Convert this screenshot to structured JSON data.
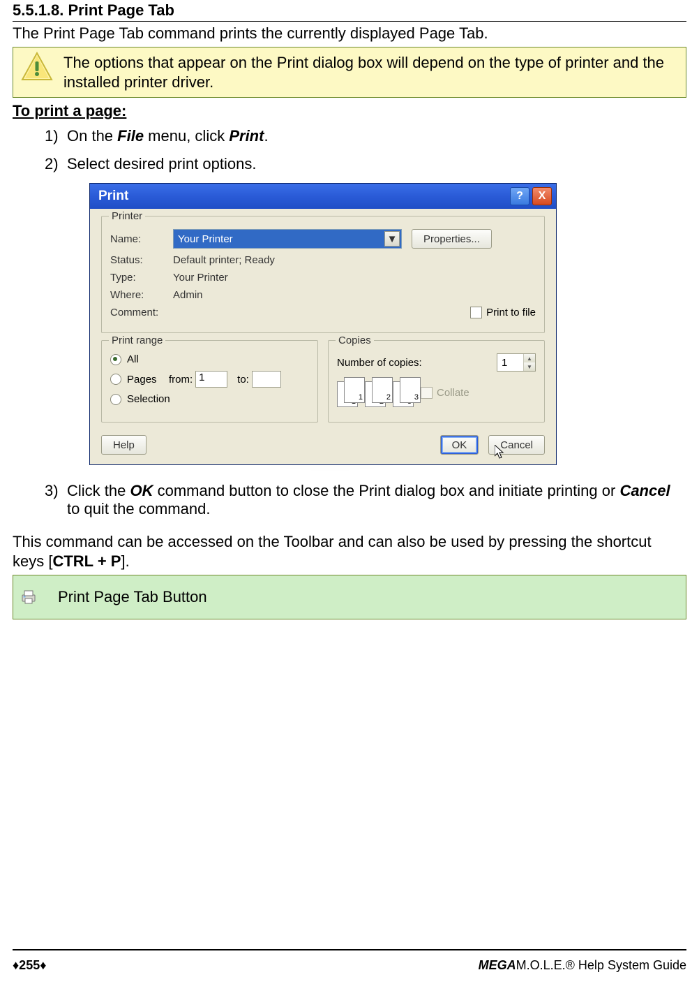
{
  "header": {
    "section_number": "5.5.1.8. Print Page Tab",
    "intro": "The Print Page Tab command prints the currently displayed Page Tab."
  },
  "note": {
    "text": "The options that appear on the Print dialog box will depend on the type of printer and the installed printer driver."
  },
  "howto_title": "To print a page:",
  "steps": {
    "s1_num": "1)",
    "s1_a": "On the ",
    "s1_file": "File",
    "s1_b": " menu, click ",
    "s1_print": "Print",
    "s1_c": ".",
    "s2_num": "2)",
    "s2_text": "Select desired print options.",
    "s3_num": "3)",
    "s3_a": "Click the ",
    "s3_ok": "OK",
    "s3_b": " command button to close the Print dialog box and initiate printing or ",
    "s3_cancel": "Cancel",
    "s3_c": " to quit the command."
  },
  "dialog": {
    "title": "Print",
    "help_glyph": "?",
    "close_glyph": "X",
    "printer": {
      "legend": "Printer",
      "name_label": "Name:",
      "name_value": "Your  Printer",
      "properties": "Properties...",
      "status_label": "Status:",
      "status_value": "Default printer; Ready",
      "type_label": "Type:",
      "type_value": "Your  Printer",
      "where_label": "Where:",
      "where_value": "Admin",
      "comment_label": "Comment:",
      "print_to_file": "Print to file"
    },
    "range": {
      "legend": "Print range",
      "all": "All",
      "pages": "Pages",
      "from": "from:",
      "from_val": "1",
      "to": "to:",
      "to_val": "",
      "selection": "Selection"
    },
    "copies": {
      "legend": "Copies",
      "num_label": "Number of copies:",
      "num_value": "1",
      "collate": "Collate",
      "page_labels": [
        "1",
        "1",
        "2",
        "2",
        "3",
        "3"
      ]
    },
    "buttons": {
      "help": "Help",
      "ok": "OK",
      "cancel": "Cancel"
    }
  },
  "para": {
    "a": "This command can be accessed on the Toolbar and can also be used by pressing the shortcut keys [",
    "b": "CTRL + P",
    "c": "]."
  },
  "greenbox": {
    "text": "Print Page Tab Button"
  },
  "footer": {
    "page": "♦255♦",
    "guide_mega": "MEGA",
    "guide_rest": "M.O.L.E.® Help System Guide"
  }
}
